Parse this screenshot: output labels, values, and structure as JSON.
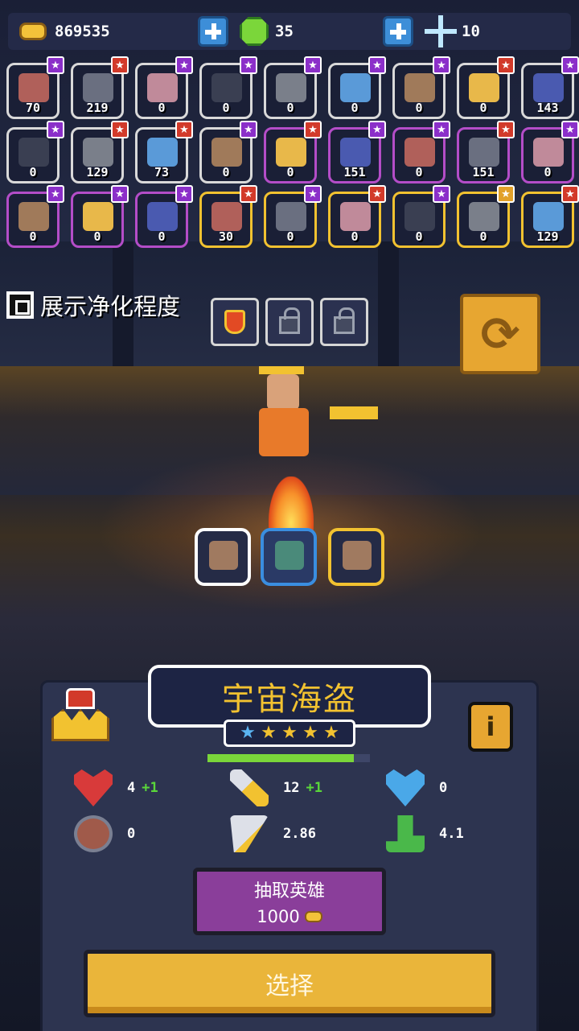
{
  "resources": {
    "gold": "869535",
    "gems": "35",
    "stars": "10"
  },
  "hero_rows": [
    [
      {
        "count": "70",
        "badge": "★",
        "badge_color": "purple",
        "frame": "white"
      },
      {
        "count": "219",
        "badge": "★",
        "badge_color": "red",
        "frame": "white"
      },
      {
        "count": "0",
        "badge": "★",
        "badge_color": "purple",
        "frame": "white"
      },
      {
        "count": "0",
        "badge": "★",
        "badge_color": "purple",
        "frame": "white"
      },
      {
        "count": "0",
        "badge": "★",
        "badge_color": "purple",
        "frame": "white"
      },
      {
        "count": "0",
        "badge": "★",
        "badge_color": "purple",
        "frame": "white"
      },
      {
        "count": "0",
        "badge": "★",
        "badge_color": "purple",
        "frame": "white"
      },
      {
        "count": "0",
        "badge": "★",
        "badge_color": "red",
        "frame": "white"
      },
      {
        "count": "143",
        "badge": "★",
        "badge_color": "purple",
        "frame": "white"
      }
    ],
    [
      {
        "count": "0",
        "badge": "★",
        "badge_color": "purple",
        "frame": "white"
      },
      {
        "count": "129",
        "badge": "★",
        "badge_color": "red",
        "frame": "white"
      },
      {
        "count": "73",
        "badge": "★",
        "badge_color": "red",
        "frame": "white"
      },
      {
        "count": "0",
        "badge": "★",
        "badge_color": "purple",
        "frame": "white"
      },
      {
        "count": "0",
        "badge": "★",
        "badge_color": "red",
        "frame": "purple"
      },
      {
        "count": "151",
        "badge": "★",
        "badge_color": "purple",
        "frame": "purple"
      },
      {
        "count": "0",
        "badge": "★",
        "badge_color": "purple",
        "frame": "purple"
      },
      {
        "count": "151",
        "badge": "★",
        "badge_color": "red",
        "frame": "purple"
      },
      {
        "count": "0",
        "badge": "★",
        "badge_color": "purple",
        "frame": "purple"
      }
    ],
    [
      {
        "count": "0",
        "badge": "★",
        "badge_color": "purple",
        "frame": "purple"
      },
      {
        "count": "0",
        "badge": "★",
        "badge_color": "purple",
        "frame": "purple"
      },
      {
        "count": "0",
        "badge": "★",
        "badge_color": "purple",
        "frame": "purple"
      },
      {
        "count": "30",
        "badge": "★",
        "badge_color": "red",
        "frame": "gold"
      },
      {
        "count": "0",
        "badge": "★",
        "badge_color": "purple",
        "frame": "gold"
      },
      {
        "count": "0",
        "badge": "★",
        "badge_color": "red",
        "frame": "gold"
      },
      {
        "count": "0",
        "badge": "★",
        "badge_color": "purple",
        "frame": "gold"
      },
      {
        "count": "0",
        "badge": "★",
        "badge_color": "gold",
        "frame": "gold"
      },
      {
        "count": "129",
        "badge": "★",
        "badge_color": "red",
        "frame": "gold"
      }
    ]
  ],
  "purify": {
    "label": "展示净化程度"
  },
  "swap": {
    "glyph": "⟳"
  },
  "hero": {
    "name": "宇宙海盗",
    "stars_blue": 1,
    "stars_gold": 4,
    "xp_fraction": 0.9,
    "info_glyph": "i"
  },
  "stats": {
    "hp": "4",
    "hp_bonus": "+1",
    "attack": "12",
    "attack_bonus": "+1",
    "armor": "0",
    "shield": "0",
    "attack_speed": "2.86",
    "move_speed": "4.1"
  },
  "draw": {
    "label": "抽取英雄",
    "cost": "1000"
  },
  "select": {
    "label": "选择"
  },
  "colors": {
    "accent_gold": "#f2c230",
    "panel": "#2d3450",
    "draw_button": "#8a3e9a",
    "select_button": "#eab53a"
  }
}
